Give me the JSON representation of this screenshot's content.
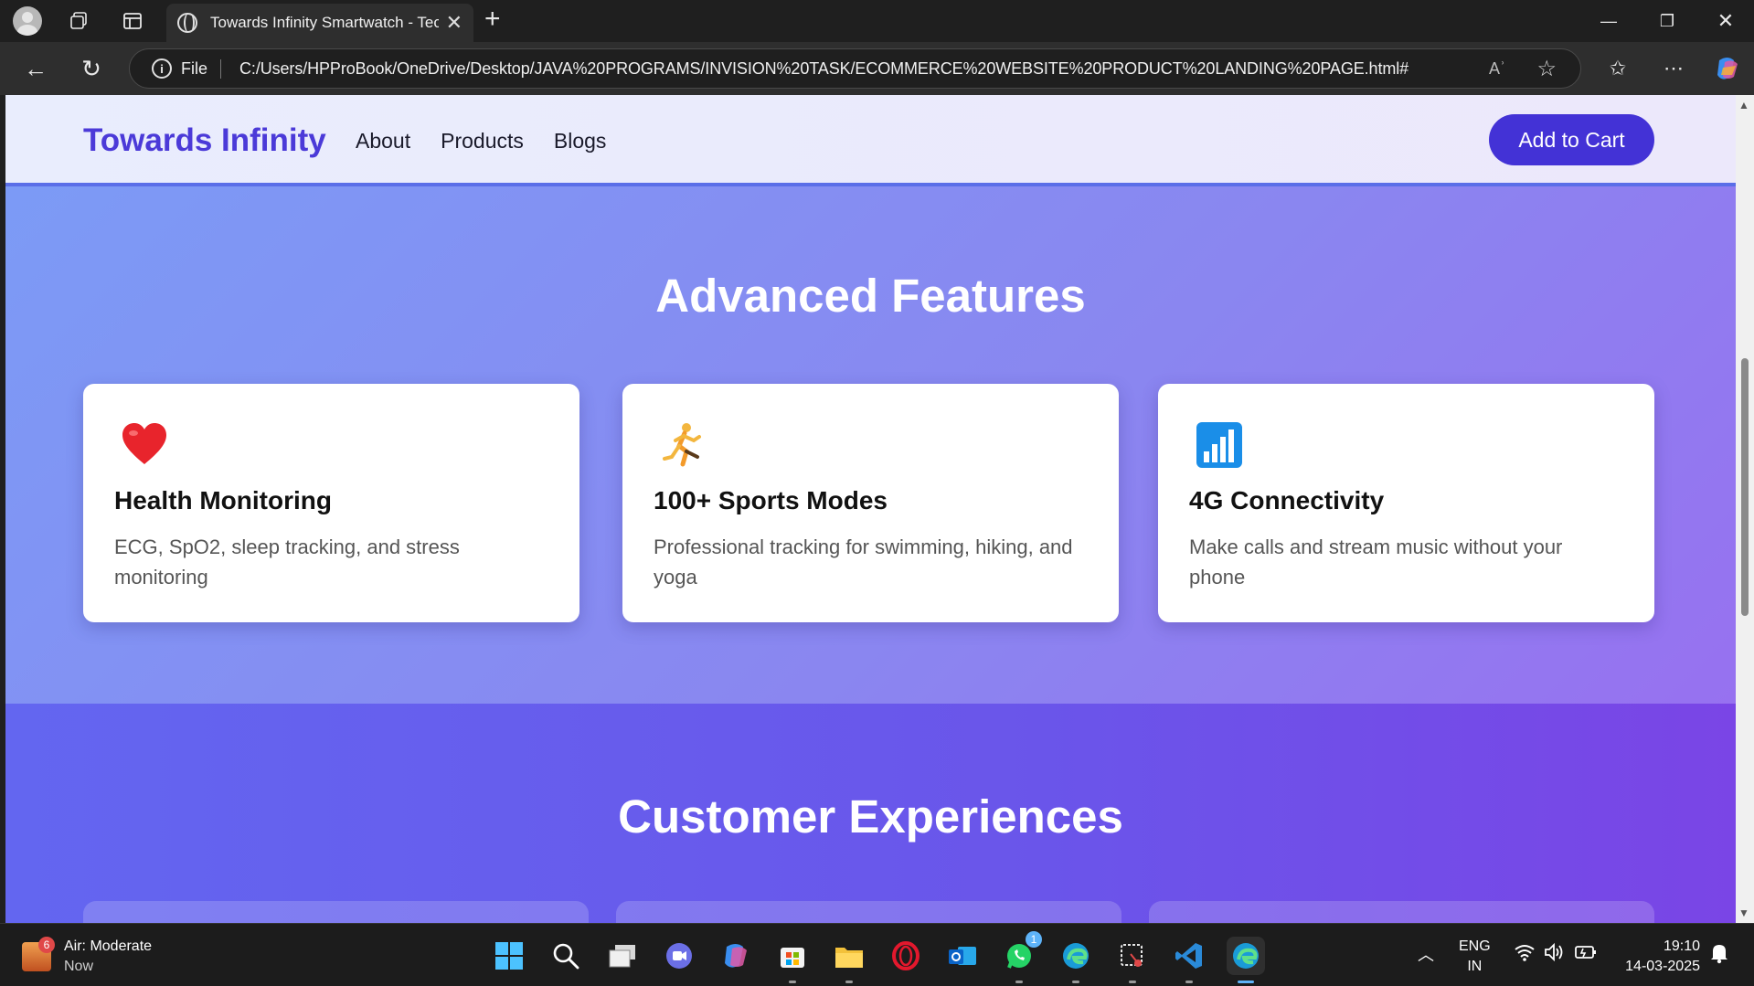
{
  "browser": {
    "tab_title": "Towards Infinity Smartwatch - Tec",
    "address_prefix": "File",
    "url": "C:/Users/HPProBook/OneDrive/Desktop/JAVA%20PROGRAMS/INVISION%20TASK/ECOMMERCE%20WEBSITE%20PRODUCT%20LANDING%20PAGE.html#",
    "read_aloud_label": "Aʾ"
  },
  "header": {
    "brand": "Towards Infinity",
    "nav": [
      {
        "label": "About"
      },
      {
        "label": "Products"
      },
      {
        "label": "Blogs"
      }
    ],
    "cta": "Add to Cart"
  },
  "features": {
    "title": "Advanced Features",
    "cards": [
      {
        "icon": "heart-icon",
        "title": "Health Monitoring",
        "description": "ECG, SpO2, sleep tracking, and stress monitoring"
      },
      {
        "icon": "runner-icon",
        "title": "100+ Sports Modes",
        "description": "Professional tracking for swimming, hiking, and yoga"
      },
      {
        "icon": "signal-bars-icon",
        "title": "4G Connectivity",
        "description": "Make calls and stream music without your phone"
      }
    ]
  },
  "experiences": {
    "title": "Customer Experiences"
  },
  "taskbar": {
    "weather_title": "Air: Moderate",
    "weather_sub": "Now",
    "weather_badge": "6",
    "whatsapp_badge": "1",
    "lang_top": "ENG",
    "lang_bottom": "IN",
    "time": "19:10",
    "date": "14-03-2025"
  },
  "colors": {
    "brand": "#4b3ad8",
    "cta_bg": "#4332d6",
    "page_gradient_start": "#7b9cf6",
    "page_gradient_end": "#9a6cf0"
  }
}
